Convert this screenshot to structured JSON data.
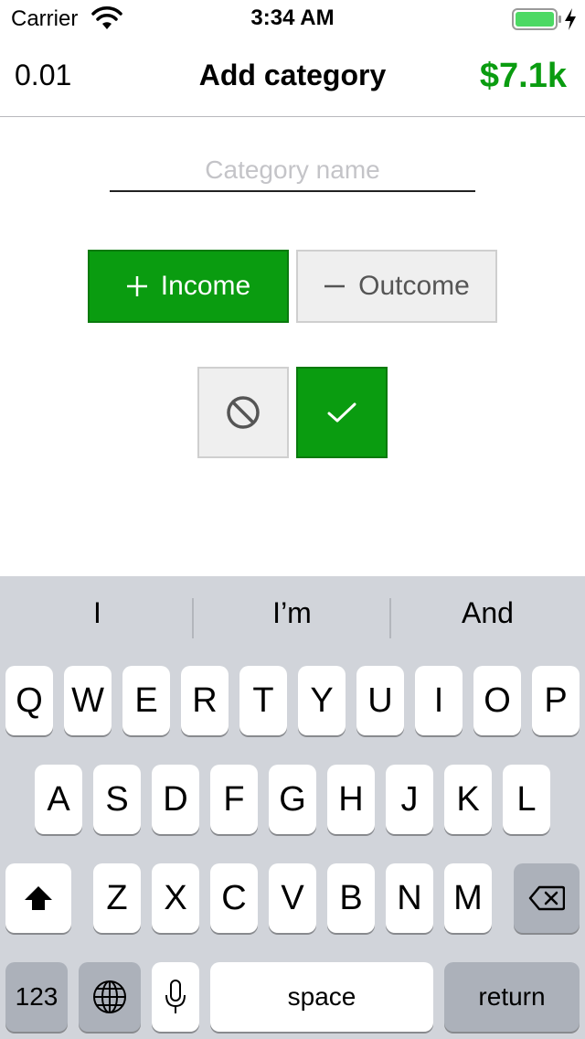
{
  "status_bar": {
    "carrier": "Carrier",
    "time": "3:34 AM",
    "wifi_icon": "wifi-icon",
    "battery_icon": "battery-icon",
    "charging_icon": "charging-bolt-icon",
    "battery_color": "#4cd964"
  },
  "nav": {
    "left_value": "0.01",
    "title": "Add category",
    "balance": "$7.1k"
  },
  "form": {
    "category_placeholder": "Category name",
    "category_value": "",
    "income_label": "Income",
    "outcome_label": "Outcome",
    "income_selected": true,
    "income_icon": "plus-icon",
    "outcome_icon": "minus-icon",
    "cancel_icon": "cancel-circle-slash-icon",
    "confirm_icon": "checkmark-icon"
  },
  "keyboard": {
    "suggestions": [
      "I",
      "I’m",
      "And"
    ],
    "rows": [
      [
        "Q",
        "W",
        "E",
        "R",
        "T",
        "Y",
        "U",
        "I",
        "O",
        "P"
      ],
      [
        "A",
        "S",
        "D",
        "F",
        "G",
        "H",
        "J",
        "K",
        "L"
      ],
      [
        "Z",
        "X",
        "C",
        "V",
        "B",
        "N",
        "M"
      ]
    ],
    "numbers_label": "123",
    "space_label": "space",
    "return_label": "return",
    "shift_icon": "shift-arrow-icon",
    "delete_icon": "backspace-icon",
    "globe_icon": "globe-icon",
    "mic_icon": "microphone-icon"
  },
  "colors": {
    "accent_green": "#0a9c10",
    "button_grey": "#efefef",
    "keyboard_bg": "#d1d4da",
    "special_key": "#acb1ba"
  }
}
